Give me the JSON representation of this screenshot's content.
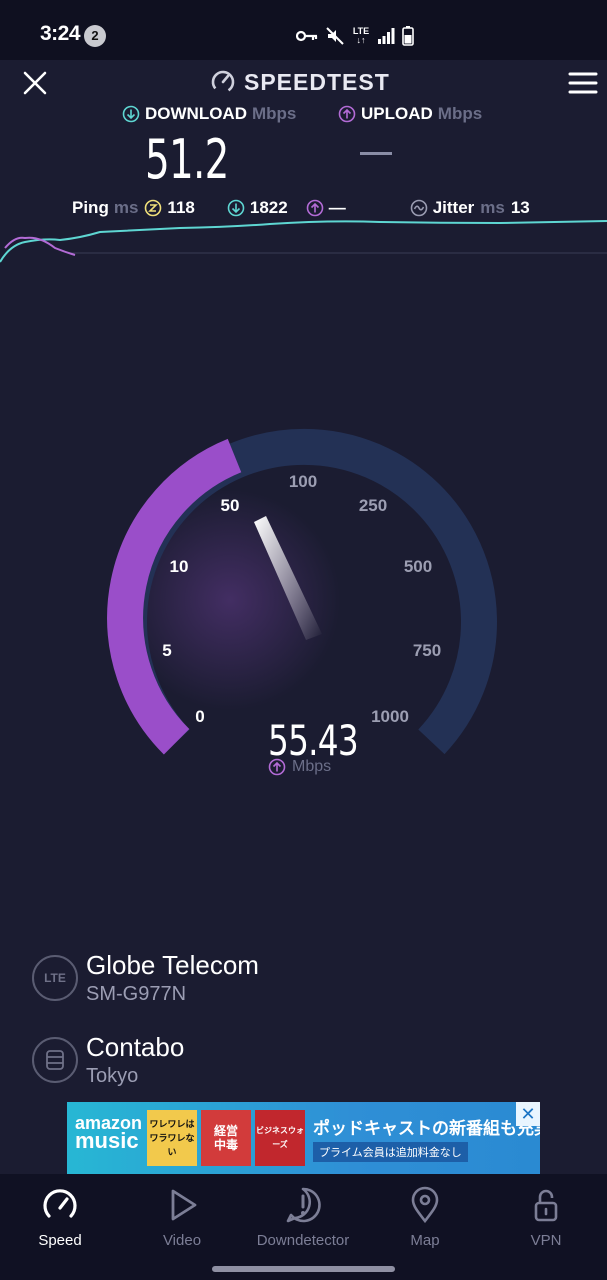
{
  "status_bar": {
    "time": "3:24",
    "notification_count": "2",
    "network": "LTE",
    "icons": [
      "key-icon",
      "mute-icon",
      "lte-icon",
      "signal-icon",
      "battery-icon"
    ]
  },
  "header": {
    "brand": "SPEEDTEST"
  },
  "results": {
    "download_label": "DOWNLOAD",
    "download_unit": "Mbps",
    "download_value": "51.2",
    "upload_label": "UPLOAD",
    "upload_unit": "Mbps",
    "upload_value": "—"
  },
  "stats": {
    "ping_label": "Ping",
    "ping_unit": "ms",
    "ping_idle": "118",
    "ping_download": "1822",
    "ping_upload": "—",
    "jitter_label": "Jitter",
    "jitter_unit": "ms",
    "jitter_value": "13"
  },
  "gauge": {
    "ticks": [
      "0",
      "5",
      "10",
      "50",
      "100",
      "250",
      "500",
      "750",
      "1000"
    ],
    "current_value": "55.43",
    "unit": "Mbps",
    "phase": "upload"
  },
  "connection": {
    "provider_badge": "LTE",
    "provider": "Globe Telecom",
    "device": "SM-G977N",
    "server": "Contabo",
    "location": "Tokyo"
  },
  "ad": {
    "logo_line1": "amazon",
    "logo_line2": "music",
    "thumb1": "ワレワレは\nワラワレない",
    "thumb2": "経営\n中毒",
    "thumb3": "ビジネスウォーズ",
    "headline": "ポッドキャストの新番組も充実",
    "subline": "プライム会員は追加料金なし",
    "close": "✕"
  },
  "nav": [
    {
      "label": "Speed",
      "icon": "speed-icon"
    },
    {
      "label": "Video",
      "icon": "play-icon"
    },
    {
      "label": "Downdetector",
      "icon": "alert-icon"
    },
    {
      "label": "Map",
      "icon": "map-pin-icon"
    },
    {
      "label": "VPN",
      "icon": "lock-icon"
    }
  ],
  "colors": {
    "background": "#1b1c31",
    "download_accent": "#5ed6d2",
    "upload_accent": "#b36bd6",
    "gauge_track": "#233155"
  }
}
